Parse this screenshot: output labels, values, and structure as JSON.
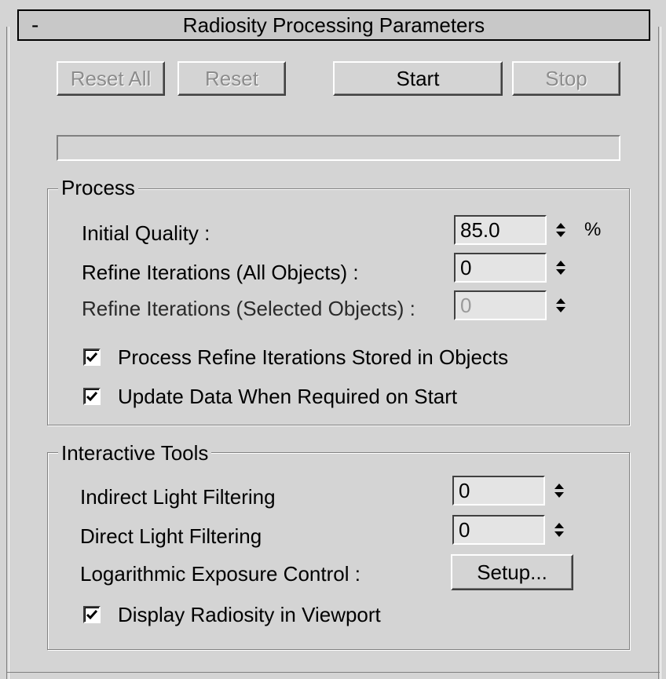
{
  "title": "Radiosity Processing Parameters",
  "collapse_symbol": "-",
  "toolbar": {
    "reset_all": "Reset All",
    "reset": "Reset",
    "start": "Start",
    "stop": "Stop"
  },
  "progress": 0,
  "process": {
    "title": "Process",
    "initial_quality_label": "Initial Quality :",
    "initial_quality_value": "85.0",
    "initial_quality_unit": "%",
    "refine_all_label": "Refine Iterations (All Objects) :",
    "refine_all_value": "0",
    "refine_selected_label": "Refine Iterations (Selected Objects) :",
    "refine_selected_value": "0",
    "process_refine_label": "Process Refine Iterations Stored in Objects",
    "process_refine_checked": true,
    "update_data_label": "Update Data When Required on Start",
    "update_data_checked": true
  },
  "interactive": {
    "title": "Interactive Tools",
    "indirect_label": "Indirect Light Filtering",
    "indirect_value": "0",
    "direct_label": "Direct Light Filtering",
    "direct_value": "0",
    "exposure_label": "Logarithmic Exposure Control :",
    "setup_label": "Setup...",
    "display_label": "Display Radiosity in Viewport",
    "display_checked": true
  }
}
